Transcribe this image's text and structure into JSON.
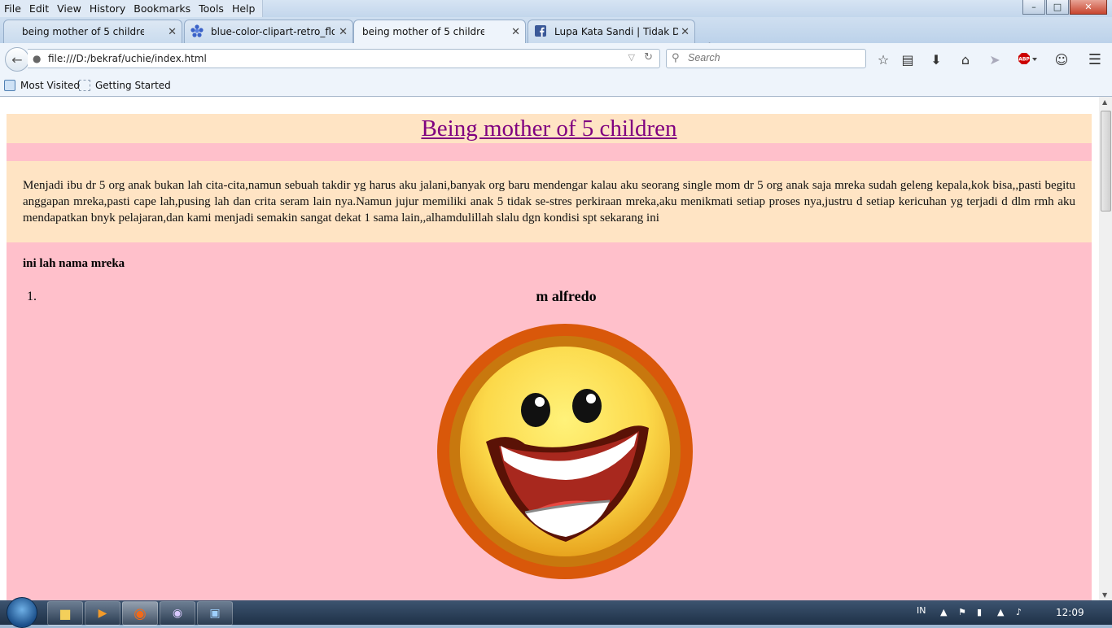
{
  "menu": [
    "File",
    "Edit",
    "View",
    "History",
    "Bookmarks",
    "Tools",
    "Help"
  ],
  "tabs": [
    {
      "title": "being mother of 5 children",
      "icon": "none",
      "active": false
    },
    {
      "title": "blue-color-clipart-retro_flo...",
      "icon": "blue-flower-icon",
      "active": false
    },
    {
      "title": "being mother of 5 children",
      "icon": "none",
      "active": true
    },
    {
      "title": "Lupa Kata Sandi | Tidak Da...",
      "icon": "facebook-icon",
      "active": false
    }
  ],
  "nav": {
    "url": "file:///D:/bekraf/uchie/index.html",
    "search_placeholder": "Search"
  },
  "bookmarks": [
    "Most Visited",
    "Getting Started"
  ],
  "page": {
    "title": "Being mother of 5 children",
    "intro": "Menjadi ibu dr 5 org anak bukan lah cita-cita,namun sebuah takdir yg harus aku jalani,banyak org baru mendengar kalau aku seorang single mom dr 5 org anak saja mreka sudah geleng kepala,kok bisa,,pasti begitu anggapan mreka,pasti cape lah,pusing lah dan crita seram lain nya.Namun jujur memiliki anak 5 tidak se-stres perkiraan mreka,aku menikmati setiap proses nya,justru d setiap kericuhan yg terjadi d dlm rmh aku mendapatkan bnyk pelajaran,dan kami menjadi semakin sangat dekat 1 sama lain,,alhamdulillah slalu dgn kondisi spt sekarang ini",
    "names_heading": "ini lah nama mreka",
    "list_number": "1.",
    "child_name": "m alfredo"
  },
  "taskbar": {
    "lang": "IN",
    "time": "12:09"
  },
  "colors": {
    "bisque": "#ffe4c4",
    "pink": "#ffc0cb",
    "title_link": "#800080"
  }
}
